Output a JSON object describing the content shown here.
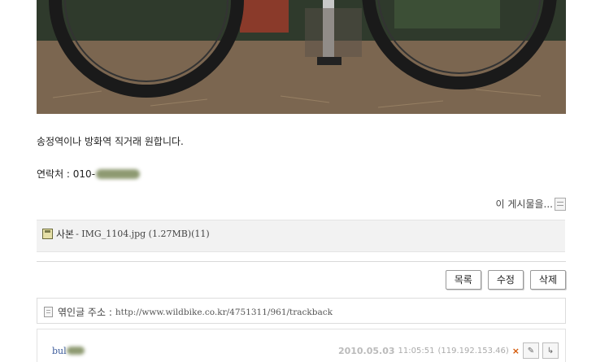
{
  "post": {
    "body_line1": "송정역이나 방화역 직거래 원합니다.",
    "contact_label": "연락처 : 010-"
  },
  "post_menu": {
    "label": "이 게시물을...",
    "icon": "list-menu-icon"
  },
  "attachment": {
    "label": "사본",
    "file": " - IMG_1104.jpg (1.27MB)(11)",
    "icon": "disk-icon"
  },
  "actions": {
    "list_label": "목록",
    "edit_label": "수정",
    "delete_label": "삭제"
  },
  "trackback": {
    "label": "엮인글 주소 :",
    "url": "http://www.wildbike.co.kr/4751311/961/trackback"
  },
  "comment": {
    "author_visible": "bul",
    "date": "2010.05.03",
    "time": "11:05:51",
    "ip": "(119.192.153.46)",
    "delete_mark": "×"
  },
  "colors": {
    "link": "#3a5a9a",
    "delete_mark": "#d35400",
    "attach_bg": "#f2f2f2"
  }
}
